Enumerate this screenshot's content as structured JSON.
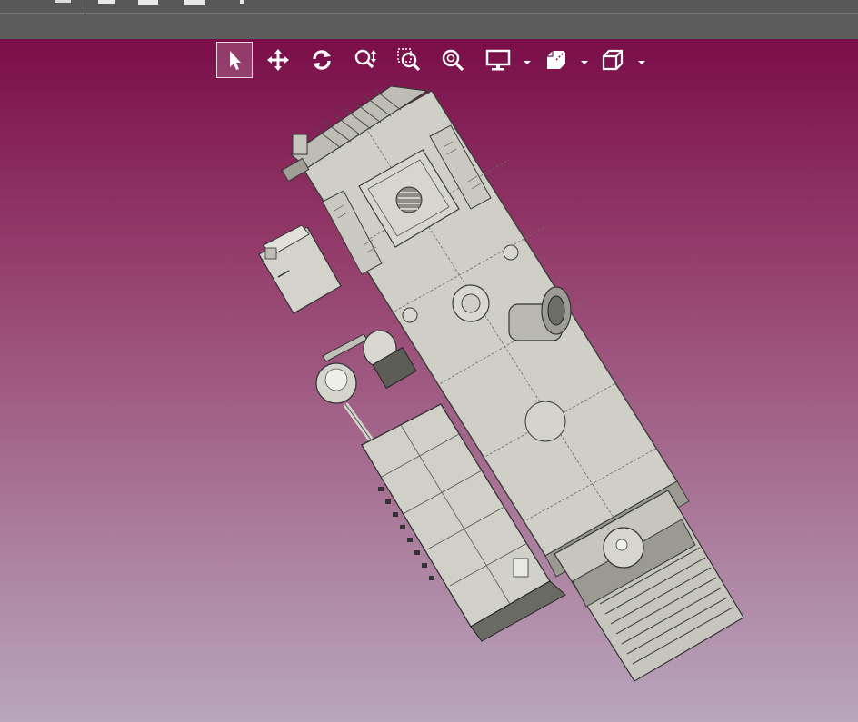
{
  "app": {
    "colors": {
      "viewport_top": "#7a0e48",
      "viewport_bottom": "#b8a6bc",
      "toolbar_bg": "#585858",
      "icon": "#ffffff",
      "model_fill": "#cfcfc7"
    }
  },
  "toolbar": {
    "tools": [
      {
        "name": "select",
        "icon": "arrow-cursor-icon",
        "active": true
      },
      {
        "name": "pan",
        "icon": "move-arrows-icon",
        "active": false
      },
      {
        "name": "rotate",
        "icon": "rotate-icon",
        "active": false
      },
      {
        "name": "zoom",
        "icon": "zoom-updown-icon",
        "active": false
      },
      {
        "name": "zoom-window",
        "icon": "zoom-window-icon",
        "active": false
      },
      {
        "name": "zoom-fit",
        "icon": "zoom-fit-icon",
        "active": false
      },
      {
        "name": "display-mode",
        "icon": "monitor-icon",
        "active": false,
        "dropdown": true
      },
      {
        "name": "section",
        "icon": "section-plane-icon",
        "active": false,
        "dropdown": true
      },
      {
        "name": "view-orientation",
        "icon": "cube-view-icon",
        "active": false,
        "dropdown": true
      }
    ]
  },
  "model": {
    "description_icon": "cad-machine-assembly"
  }
}
